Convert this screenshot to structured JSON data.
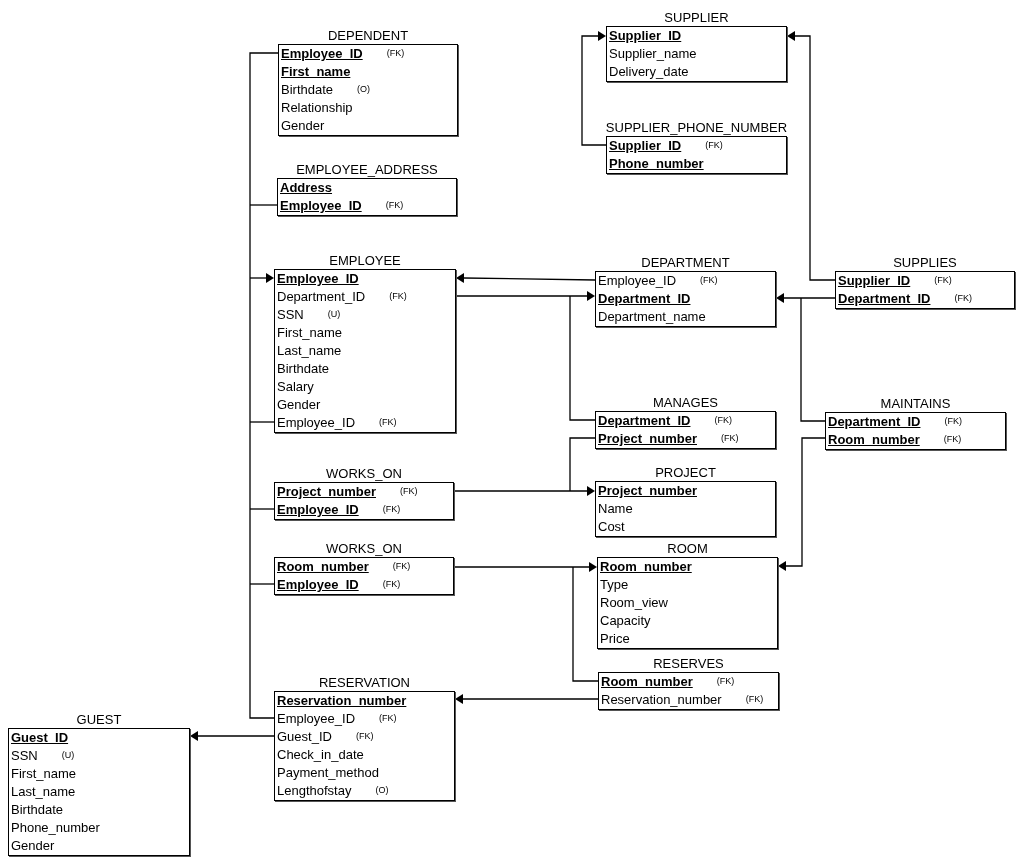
{
  "tables": [
    {
      "name": "DEPENDENT",
      "fields": [
        {
          "name": "Employee_ID",
          "key": true,
          "note": "(FK)"
        },
        {
          "name": "First_name",
          "key": true
        },
        {
          "name": "Birthdate",
          "key": false,
          "note": "(O)"
        },
        {
          "name": "Relationship",
          "key": false
        },
        {
          "name": "Gender",
          "key": false
        }
      ]
    },
    {
      "name": "EMPLOYEE_ADDRESS",
      "fields": [
        {
          "name": "Address",
          "key": true
        },
        {
          "name": "Employee_ID",
          "key": true,
          "note": "(FK)"
        }
      ]
    },
    {
      "name": "EMPLOYEE",
      "fields": [
        {
          "name": "Employee_ID",
          "key": true
        },
        {
          "name": "Department_ID",
          "key": false,
          "note": "(FK)"
        },
        {
          "name": "SSN",
          "key": false,
          "note": "(U)"
        },
        {
          "name": "First_name",
          "key": false
        },
        {
          "name": "Last_name",
          "key": false
        },
        {
          "name": "Birthdate",
          "key": false
        },
        {
          "name": "Salary",
          "key": false
        },
        {
          "name": "Gender",
          "key": false
        },
        {
          "name": "Employee_ID",
          "key": false,
          "note": "(FK)"
        }
      ]
    },
    {
      "name": "WORKS_ON",
      "fields": [
        {
          "name": "Project_number",
          "key": true,
          "note": "(FK)"
        },
        {
          "name": "Employee_ID",
          "key": true,
          "note": "(FK)"
        }
      ]
    },
    {
      "name": "WORKS_ON",
      "fields": [
        {
          "name": "Room_number",
          "key": true,
          "note": "(FK)"
        },
        {
          "name": "Employee_ID",
          "key": true,
          "note": "(FK)"
        }
      ]
    },
    {
      "name": "RESERVATION",
      "fields": [
        {
          "name": "Reservation_number",
          "key": true
        },
        {
          "name": "Employee_ID",
          "key": false,
          "note": "(FK)"
        },
        {
          "name": "Guest_ID",
          "key": false,
          "note": "(FK)"
        },
        {
          "name": "Check_in_date",
          "key": false
        },
        {
          "name": "Payment_method",
          "key": false
        },
        {
          "name": "Lengthofstay",
          "key": false,
          "note": "(O)"
        }
      ]
    },
    {
      "name": "GUEST",
      "fields": [
        {
          "name": "Guest_ID",
          "key": true
        },
        {
          "name": "SSN",
          "key": false,
          "note": "(U)"
        },
        {
          "name": "First_name",
          "key": false
        },
        {
          "name": "Last_name",
          "key": false
        },
        {
          "name": "Birthdate",
          "key": false
        },
        {
          "name": "Phone_number",
          "key": false
        },
        {
          "name": "Gender",
          "key": false
        }
      ]
    },
    {
      "name": "SUPPLIER",
      "fields": [
        {
          "name": "Supplier_ID",
          "key": true
        },
        {
          "name": "Supplier_name",
          "key": false
        },
        {
          "name": "Delivery_date",
          "key": false
        }
      ]
    },
    {
      "name": "SUPPLIER_PHONE_NUMBER",
      "fields": [
        {
          "name": "Supplier_ID",
          "key": true,
          "note": "(FK)"
        },
        {
          "name": "Phone_number",
          "key": true
        }
      ]
    },
    {
      "name": "DEPARTMENT",
      "fields": [
        {
          "name": "Employee_ID",
          "key": false,
          "note": "(FK)"
        },
        {
          "name": "Department_ID",
          "key": true
        },
        {
          "name": "Department_name",
          "key": false
        }
      ]
    },
    {
      "name": "SUPPLIES",
      "fields": [
        {
          "name": "Supplier_ID",
          "key": true,
          "note": "(FK)"
        },
        {
          "name": "Department_ID",
          "key": true,
          "note": "(FK)"
        }
      ]
    },
    {
      "name": "MANAGES",
      "fields": [
        {
          "name": "Department_ID",
          "key": true,
          "note": "(FK)"
        },
        {
          "name": "Project_number",
          "key": true,
          "note": "(FK)"
        }
      ]
    },
    {
      "name": "MAINTAINS",
      "fields": [
        {
          "name": "Department_ID",
          "key": true,
          "note": "(FK)"
        },
        {
          "name": "Room_number",
          "key": true,
          "note": "(FK)"
        }
      ]
    },
    {
      "name": "PROJECT",
      "fields": [
        {
          "name": "Project_number",
          "key": true
        },
        {
          "name": "Name",
          "key": false
        },
        {
          "name": "Cost",
          "key": false
        }
      ]
    },
    {
      "name": "ROOM",
      "fields": [
        {
          "name": "Room_number",
          "key": true
        },
        {
          "name": "Type",
          "key": false
        },
        {
          "name": "Room_view",
          "key": false
        },
        {
          "name": "Capacity",
          "key": false
        },
        {
          "name": "Price",
          "key": false
        }
      ]
    },
    {
      "name": "RESERVES",
      "fields": [
        {
          "name": "Room_number",
          "key": true,
          "note": "(FK)"
        },
        {
          "name": "Reservation_number",
          "key": false,
          "note": "(FK)"
        }
      ]
    }
  ]
}
